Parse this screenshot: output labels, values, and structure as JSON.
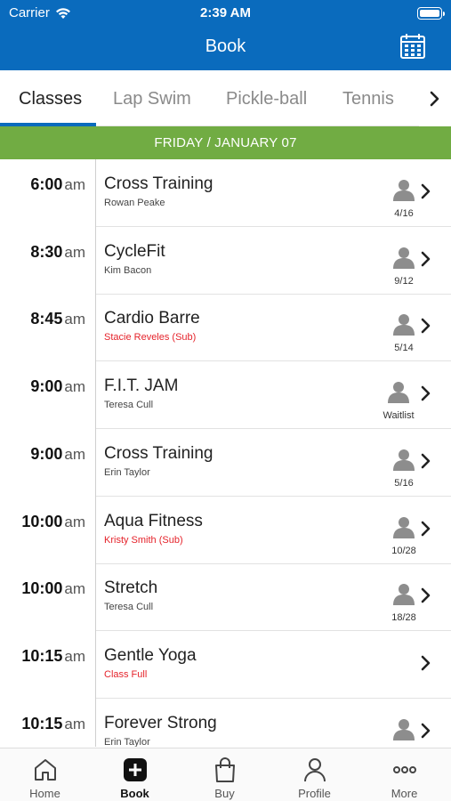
{
  "status_bar": {
    "carrier": "Carrier",
    "time": "2:39 AM"
  },
  "header": {
    "title": "Book"
  },
  "tabs": [
    {
      "label": "Classes",
      "active": true
    },
    {
      "label": "Lap Swim",
      "active": false
    },
    {
      "label": "Pickle-ball",
      "active": false
    },
    {
      "label": "Tennis",
      "active": false
    }
  ],
  "date_banner": "FRIDAY / JANUARY 07",
  "classes": [
    {
      "time": "6:00",
      "ampm": "am",
      "name": "Cross Training",
      "instructor": "Rowan Peake",
      "instructor_red": false,
      "capacity": "4/16"
    },
    {
      "time": "8:30",
      "ampm": "am",
      "name": "CycleFit",
      "instructor": "Kim Bacon",
      "instructor_red": false,
      "capacity": "9/12"
    },
    {
      "time": "8:45",
      "ampm": "am",
      "name": "Cardio Barre",
      "instructor": "Stacie Reveles (Sub)",
      "instructor_red": true,
      "capacity": "5/14"
    },
    {
      "time": "9:00",
      "ampm": "am",
      "name": "F.I.T. JAM",
      "instructor": "Teresa Cull",
      "instructor_red": false,
      "capacity": "Waitlist"
    },
    {
      "time": "9:00",
      "ampm": "am",
      "name": "Cross Training",
      "instructor": "Erin Taylor",
      "instructor_red": false,
      "capacity": "5/16"
    },
    {
      "time": "10:00",
      "ampm": "am",
      "name": "Aqua Fitness",
      "instructor": "Kristy Smith (Sub)",
      "instructor_red": true,
      "capacity": "10/28"
    },
    {
      "time": "10:00",
      "ampm": "am",
      "name": "Stretch",
      "instructor": "Teresa Cull",
      "instructor_red": false,
      "capacity": "18/28"
    },
    {
      "time": "10:15",
      "ampm": "am",
      "name": "Gentle Yoga",
      "instructor": "Class Full",
      "instructor_red": true,
      "capacity": ""
    },
    {
      "time": "10:15",
      "ampm": "am",
      "name": "Forever Strong",
      "instructor": "Erin Taylor",
      "instructor_red": false,
      "capacity": ""
    }
  ],
  "bottom_nav": [
    {
      "label": "Home",
      "icon": "home-icon"
    },
    {
      "label": "Book",
      "icon": "plus-square-icon",
      "active": true
    },
    {
      "label": "Buy",
      "icon": "shopping-bag-icon"
    },
    {
      "label": "Profile",
      "icon": "person-icon"
    },
    {
      "label": "More",
      "icon": "ellipsis-icon"
    }
  ],
  "colors": {
    "header": "#0a6bbd",
    "date_banner": "#71ac43",
    "sub_text": "#e5232b"
  }
}
